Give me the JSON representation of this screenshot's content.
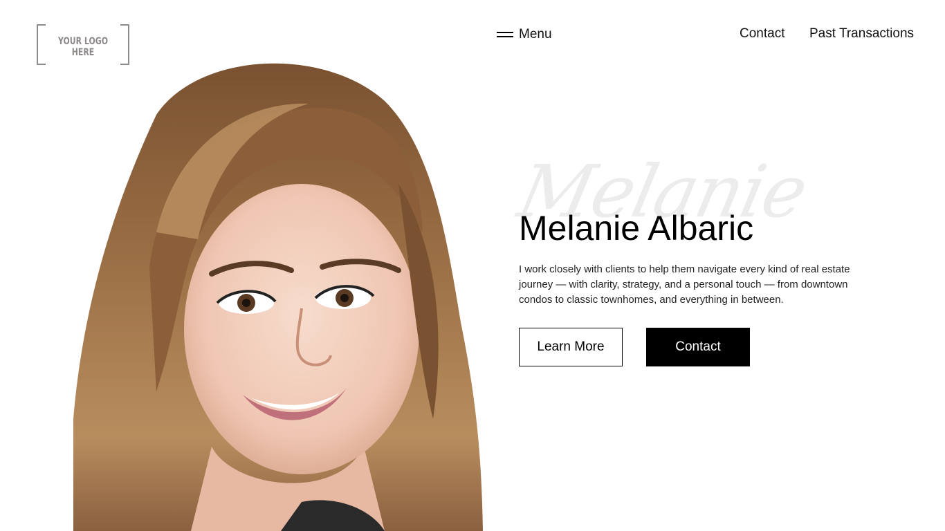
{
  "logo": {
    "text": "YOUR LOGO HERE"
  },
  "nav": {
    "menu_label": "Menu",
    "contact_label": "Contact",
    "past_transactions_label": "Past Transactions"
  },
  "hero": {
    "script_name": "Melanie",
    "name": "Melanie Albaric",
    "bio": "I work closely with clients to help them navigate every kind of real estate journey — with clarity, strategy, and a personal touch — from downtown condos to classic townhomes, and everything in between.",
    "learn_more_label": "Learn More",
    "contact_label": "Contact"
  }
}
